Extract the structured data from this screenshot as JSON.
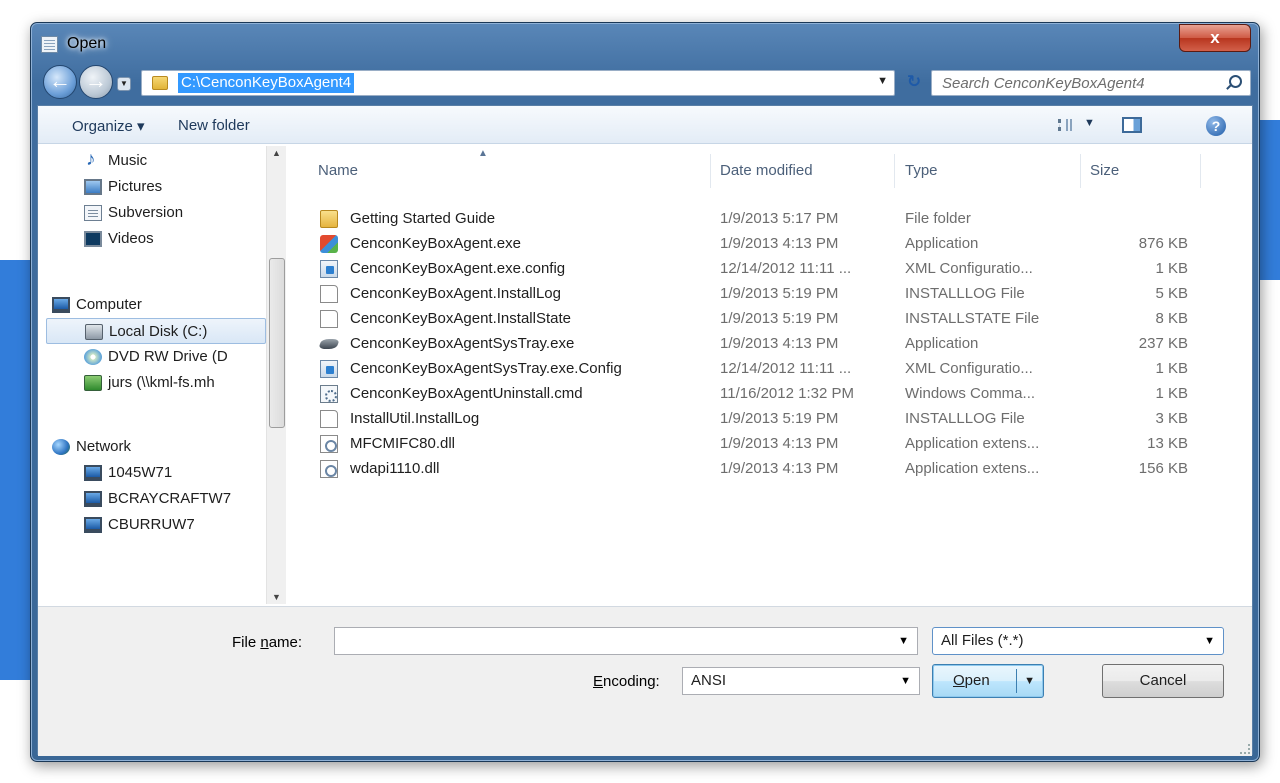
{
  "window": {
    "title": "Open",
    "close_label": "x"
  },
  "address": {
    "path": "C:\\CenconKeyBoxAgent4",
    "search_placeholder": "Search CenconKeyBoxAgent4"
  },
  "toolbar": {
    "organize_label": "Organize ▾",
    "new_folder_label": "New folder"
  },
  "nav": {
    "items": [
      {
        "label": "Music",
        "icon": "music-icon"
      },
      {
        "label": "Pictures",
        "icon": "pictures-icon"
      },
      {
        "label": "Subversion",
        "icon": "document-icon"
      },
      {
        "label": "Videos",
        "icon": "videos-icon"
      },
      {
        "label": "Computer",
        "icon": "computer-icon"
      },
      {
        "label": "Local Disk (C:)",
        "icon": "disk-icon"
      },
      {
        "label": "DVD RW Drive (D",
        "icon": "dvd-icon"
      },
      {
        "label": "jurs (\\\\kml-fs.mh",
        "icon": "network-drive-icon"
      },
      {
        "label": "Network",
        "icon": "network-icon"
      },
      {
        "label": "1045W71",
        "icon": "computer-icon"
      },
      {
        "label": "BCRAYCRAFTW7",
        "icon": "computer-icon"
      },
      {
        "label": "CBURRUW7",
        "icon": "computer-icon"
      }
    ]
  },
  "columns": {
    "name": "Name",
    "date": "Date modified",
    "type": "Type",
    "size": "Size"
  },
  "files": [
    {
      "name": "Getting Started Guide",
      "date": "1/9/2013 5:17 PM",
      "type": "File folder",
      "size": "",
      "icon": "folder-icon"
    },
    {
      "name": "CenconKeyBoxAgent.exe",
      "date": "1/9/2013 4:13 PM",
      "type": "Application",
      "size": "876 KB",
      "icon": "application-icon"
    },
    {
      "name": "CenconKeyBoxAgent.exe.config",
      "date": "12/14/2012 11:11 ...",
      "type": "XML Configuratio...",
      "size": "1 KB",
      "icon": "config-file-icon"
    },
    {
      "name": "CenconKeyBoxAgent.InstallLog",
      "date": "1/9/2013 5:19 PM",
      "type": "INSTALLLOG File",
      "size": "5 KB",
      "icon": "blank-file-icon"
    },
    {
      "name": "CenconKeyBoxAgent.InstallState",
      "date": "1/9/2013 5:19 PM",
      "type": "INSTALLSTATE File",
      "size": "8 KB",
      "icon": "blank-file-icon"
    },
    {
      "name": "CenconKeyBoxAgentSysTray.exe",
      "date": "1/9/2013 4:13 PM",
      "type": "Application",
      "size": "237 KB",
      "icon": "tray-app-icon"
    },
    {
      "name": "CenconKeyBoxAgentSysTray.exe.Config",
      "date": "12/14/2012 11:11 ...",
      "type": "XML Configuratio...",
      "size": "1 KB",
      "icon": "config-file-icon"
    },
    {
      "name": "CenconKeyBoxAgentUninstall.cmd",
      "date": "11/16/2012 1:32 PM",
      "type": "Windows Comma...",
      "size": "1 KB",
      "icon": "cmd-file-icon"
    },
    {
      "name": "InstallUtil.InstallLog",
      "date": "1/9/2013 5:19 PM",
      "type": "INSTALLLOG File",
      "size": "3 KB",
      "icon": "blank-file-icon"
    },
    {
      "name": "MFCMIFC80.dll",
      "date": "1/9/2013 4:13 PM",
      "type": "Application extens...",
      "size": "13 KB",
      "icon": "dll-file-icon"
    },
    {
      "name": "wdapi1110.dll",
      "date": "1/9/2013 4:13 PM",
      "type": "Application extens...",
      "size": "156 KB",
      "icon": "dll-file-icon"
    }
  ],
  "footer": {
    "filename_label_pre": "File ",
    "filename_label_key": "n",
    "filename_label_post": "ame:",
    "filename_value": "",
    "filter_value": "All Files  (*.*)",
    "encoding_label_key": "E",
    "encoding_label_post": "ncoding:",
    "encoding_value": "ANSI",
    "open_label_key": "O",
    "open_label_post": "pen",
    "cancel_label": "Cancel"
  }
}
